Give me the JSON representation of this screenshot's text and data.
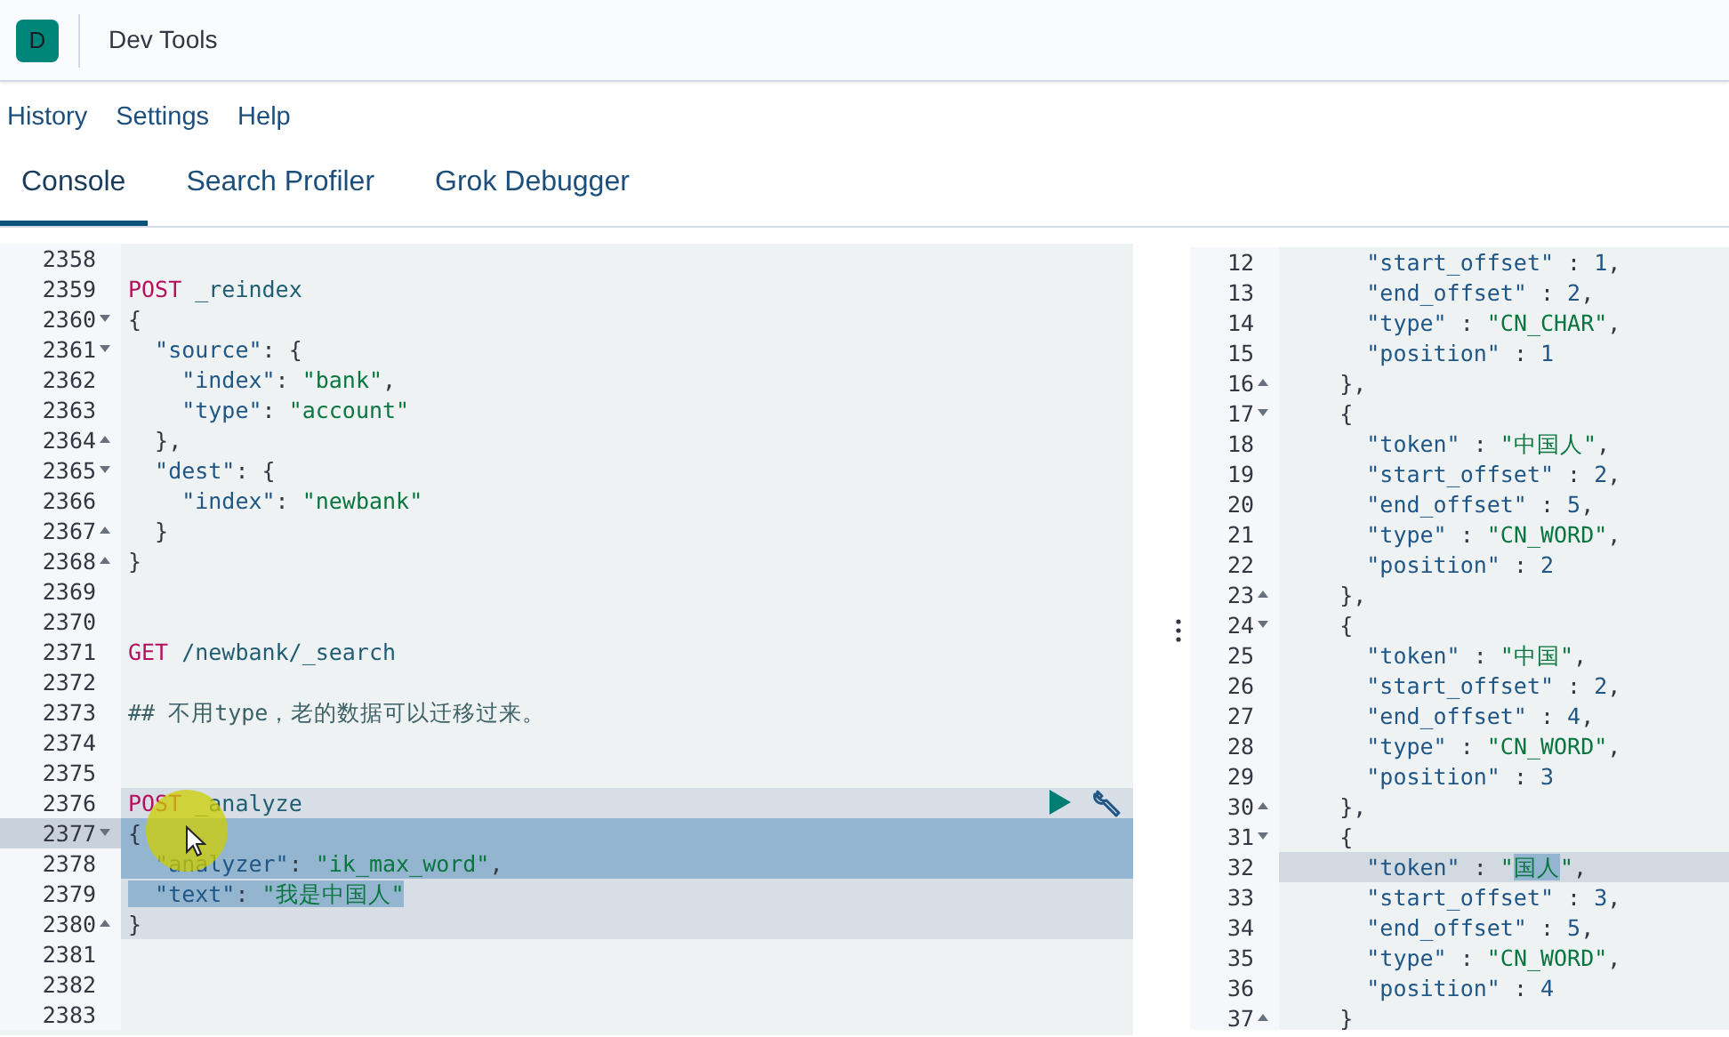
{
  "header": {
    "logo_letter": "D",
    "title": "Dev Tools"
  },
  "menu": [
    "History",
    "Settings",
    "Help"
  ],
  "tabs": [
    {
      "label": "Console",
      "selected": true
    },
    {
      "label": "Search Profiler",
      "selected": false
    },
    {
      "label": "Grok Debugger",
      "selected": false
    }
  ],
  "request_editor": {
    "lines": [
      {
        "number": "2358"
      },
      {
        "number": "2359",
        "segments": [
          {
            "text": "POST",
            "kind": "method"
          },
          {
            "text": " _reindex",
            "kind": "path"
          }
        ]
      },
      {
        "number": "2360",
        "fold_start": true,
        "segments": [
          {
            "text": "{",
            "kind": "plain"
          }
        ]
      },
      {
        "number": "2361",
        "fold_start": true,
        "segments": [
          {
            "text": "  \"source\"",
            "kind": "key"
          },
          {
            "text": ": {",
            "kind": "plain"
          }
        ]
      },
      {
        "number": "2362",
        "segments": [
          {
            "text": "    \"index\"",
            "kind": "key"
          },
          {
            "text": ": ",
            "kind": "plain"
          },
          {
            "text": "\"bank\"",
            "kind": "string"
          },
          {
            "text": ",",
            "kind": "plain"
          }
        ]
      },
      {
        "number": "2363",
        "segments": [
          {
            "text": "    \"type\"",
            "kind": "key"
          },
          {
            "text": ": ",
            "kind": "plain"
          },
          {
            "text": "\"account\"",
            "kind": "string"
          }
        ]
      },
      {
        "number": "2364",
        "fold_end": true,
        "segments": [
          {
            "text": "  },",
            "kind": "plain"
          }
        ]
      },
      {
        "number": "2365",
        "fold_start": true,
        "segments": [
          {
            "text": "  \"dest\"",
            "kind": "key"
          },
          {
            "text": ": {",
            "kind": "plain"
          }
        ]
      },
      {
        "number": "2366",
        "segments": [
          {
            "text": "    \"index\"",
            "kind": "key"
          },
          {
            "text": ": ",
            "kind": "plain"
          },
          {
            "text": "\"newbank\"",
            "kind": "string"
          }
        ]
      },
      {
        "number": "2367",
        "fold_end": true,
        "segments": [
          {
            "text": "  }",
            "kind": "plain"
          }
        ]
      },
      {
        "number": "2368",
        "fold_end": true,
        "segments": [
          {
            "text": "}",
            "kind": "plain"
          }
        ]
      },
      {
        "number": "2369"
      },
      {
        "number": "2370"
      },
      {
        "number": "2371",
        "segments": [
          {
            "text": "GET",
            "kind": "method"
          },
          {
            "text": " /newbank/_search",
            "kind": "path"
          }
        ]
      },
      {
        "number": "2372"
      },
      {
        "number": "2373",
        "segments": [
          {
            "text": "## 不用type，老的数据可以迁移过来。",
            "kind": "comment"
          }
        ]
      },
      {
        "number": "2374"
      },
      {
        "number": "2375"
      },
      {
        "number": "2376",
        "in_request": true,
        "actions": true,
        "segments": [
          {
            "text": "POST",
            "kind": "method"
          },
          {
            "text": " _analyze",
            "kind": "path"
          }
        ]
      },
      {
        "number": "2377",
        "in_request": true,
        "active": true,
        "selected": true,
        "fold_start": true,
        "segments": [
          {
            "text": "{",
            "kind": "plain"
          }
        ]
      },
      {
        "number": "2378",
        "in_request": true,
        "selected": true,
        "segments": [
          {
            "text": "  \"analyzer\"",
            "kind": "key"
          },
          {
            "text": ": ",
            "kind": "plain"
          },
          {
            "text": "\"ik_max_word\"",
            "kind": "string"
          },
          {
            "text": ",",
            "kind": "plain"
          }
        ]
      },
      {
        "number": "2379",
        "in_request": true,
        "segments": [
          {
            "text": "  \"text\"",
            "kind": "key",
            "selected": true
          },
          {
            "text": ": ",
            "kind": "plain",
            "selected": true
          },
          {
            "text": "\"我是中国人\"",
            "kind": "string",
            "selected": true
          }
        ]
      },
      {
        "number": "2380",
        "in_request": true,
        "fold_end": true,
        "segments": [
          {
            "text": "}",
            "kind": "plain"
          }
        ]
      },
      {
        "number": "2381"
      },
      {
        "number": "2382"
      },
      {
        "number": "2383"
      }
    ]
  },
  "response_viewer": {
    "lines": [
      {
        "number": "12",
        "segments": [
          {
            "text": "      \"start_offset\"",
            "kind": "key"
          },
          {
            "text": " : ",
            "kind": "plain"
          },
          {
            "text": "1",
            "kind": "number"
          },
          {
            "text": ",",
            "kind": "plain"
          }
        ]
      },
      {
        "number": "13",
        "segments": [
          {
            "text": "      \"end_offset\"",
            "kind": "key"
          },
          {
            "text": " : ",
            "kind": "plain"
          },
          {
            "text": "2",
            "kind": "number"
          },
          {
            "text": ",",
            "kind": "plain"
          }
        ]
      },
      {
        "number": "14",
        "segments": [
          {
            "text": "      \"type\"",
            "kind": "key"
          },
          {
            "text": " : ",
            "kind": "plain"
          },
          {
            "text": "\"CN_CHAR\"",
            "kind": "string"
          },
          {
            "text": ",",
            "kind": "plain"
          }
        ]
      },
      {
        "number": "15",
        "segments": [
          {
            "text": "      \"position\"",
            "kind": "key"
          },
          {
            "text": " : ",
            "kind": "plain"
          },
          {
            "text": "1",
            "kind": "number"
          }
        ]
      },
      {
        "number": "16",
        "fold_end": true,
        "segments": [
          {
            "text": "    },",
            "kind": "plain"
          }
        ]
      },
      {
        "number": "17",
        "fold_start": true,
        "segments": [
          {
            "text": "    {",
            "kind": "plain"
          }
        ]
      },
      {
        "number": "18",
        "segments": [
          {
            "text": "      \"token\"",
            "kind": "key"
          },
          {
            "text": " : ",
            "kind": "plain"
          },
          {
            "text": "\"中国人\"",
            "kind": "string"
          },
          {
            "text": ",",
            "kind": "plain"
          }
        ]
      },
      {
        "number": "19",
        "segments": [
          {
            "text": "      \"start_offset\"",
            "kind": "key"
          },
          {
            "text": " : ",
            "kind": "plain"
          },
          {
            "text": "2",
            "kind": "number"
          },
          {
            "text": ",",
            "kind": "plain"
          }
        ]
      },
      {
        "number": "20",
        "segments": [
          {
            "text": "      \"end_offset\"",
            "kind": "key"
          },
          {
            "text": " : ",
            "kind": "plain"
          },
          {
            "text": "5",
            "kind": "number"
          },
          {
            "text": ",",
            "kind": "plain"
          }
        ]
      },
      {
        "number": "21",
        "segments": [
          {
            "text": "      \"type\"",
            "kind": "key"
          },
          {
            "text": " : ",
            "kind": "plain"
          },
          {
            "text": "\"CN_WORD\"",
            "kind": "string"
          },
          {
            "text": ",",
            "kind": "plain"
          }
        ]
      },
      {
        "number": "22",
        "segments": [
          {
            "text": "      \"position\"",
            "kind": "key"
          },
          {
            "text": " : ",
            "kind": "plain"
          },
          {
            "text": "2",
            "kind": "number"
          }
        ]
      },
      {
        "number": "23",
        "fold_end": true,
        "segments": [
          {
            "text": "    },",
            "kind": "plain"
          }
        ]
      },
      {
        "number": "24",
        "fold_start": true,
        "segments": [
          {
            "text": "    {",
            "kind": "plain"
          }
        ]
      },
      {
        "number": "25",
        "segments": [
          {
            "text": "      \"token\"",
            "kind": "key"
          },
          {
            "text": " : ",
            "kind": "plain"
          },
          {
            "text": "\"中国\"",
            "kind": "string"
          },
          {
            "text": ",",
            "kind": "plain"
          }
        ]
      },
      {
        "number": "26",
        "segments": [
          {
            "text": "      \"start_offset\"",
            "kind": "key"
          },
          {
            "text": " : ",
            "kind": "plain"
          },
          {
            "text": "2",
            "kind": "number"
          },
          {
            "text": ",",
            "kind": "plain"
          }
        ]
      },
      {
        "number": "27",
        "segments": [
          {
            "text": "      \"end_offset\"",
            "kind": "key"
          },
          {
            "text": " : ",
            "kind": "plain"
          },
          {
            "text": "4",
            "kind": "number"
          },
          {
            "text": ",",
            "kind": "plain"
          }
        ]
      },
      {
        "number": "28",
        "segments": [
          {
            "text": "      \"type\"",
            "kind": "key"
          },
          {
            "text": " : ",
            "kind": "plain"
          },
          {
            "text": "\"CN_WORD\"",
            "kind": "string"
          },
          {
            "text": ",",
            "kind": "plain"
          }
        ]
      },
      {
        "number": "29",
        "segments": [
          {
            "text": "      \"position\"",
            "kind": "key"
          },
          {
            "text": " : ",
            "kind": "plain"
          },
          {
            "text": "3",
            "kind": "number"
          }
        ]
      },
      {
        "number": "30",
        "fold_end": true,
        "segments": [
          {
            "text": "    },",
            "kind": "plain"
          }
        ]
      },
      {
        "number": "31",
        "fold_start": true,
        "segments": [
          {
            "text": "    {",
            "kind": "plain"
          }
        ]
      },
      {
        "number": "32",
        "active": true,
        "segments": [
          {
            "text": "      \"token\"",
            "kind": "key"
          },
          {
            "text": " : ",
            "kind": "plain"
          },
          {
            "text": "\"",
            "kind": "string"
          },
          {
            "text": "国人",
            "kind": "string",
            "selected": true
          },
          {
            "text": "\"",
            "kind": "string"
          },
          {
            "text": ",",
            "kind": "plain"
          }
        ]
      },
      {
        "number": "33",
        "segments": [
          {
            "text": "      \"start_offset\"",
            "kind": "key"
          },
          {
            "text": " : ",
            "kind": "plain"
          },
          {
            "text": "3",
            "kind": "number"
          },
          {
            "text": ",",
            "kind": "plain"
          }
        ]
      },
      {
        "number": "34",
        "segments": [
          {
            "text": "      \"end_offset\"",
            "kind": "key"
          },
          {
            "text": " : ",
            "kind": "plain"
          },
          {
            "text": "5",
            "kind": "number"
          },
          {
            "text": ",",
            "kind": "plain"
          }
        ]
      },
      {
        "number": "35",
        "segments": [
          {
            "text": "      \"type\"",
            "kind": "key"
          },
          {
            "text": " : ",
            "kind": "plain"
          },
          {
            "text": "\"CN_WORD\"",
            "kind": "string"
          },
          {
            "text": ",",
            "kind": "plain"
          }
        ]
      },
      {
        "number": "36",
        "segments": [
          {
            "text": "      \"position\"",
            "kind": "key"
          },
          {
            "text": " : ",
            "kind": "plain"
          },
          {
            "text": "4",
            "kind": "number"
          }
        ]
      },
      {
        "number": "37",
        "fold_end": true,
        "segments": [
          {
            "text": "    }",
            "kind": "plain"
          }
        ]
      }
    ]
  }
}
